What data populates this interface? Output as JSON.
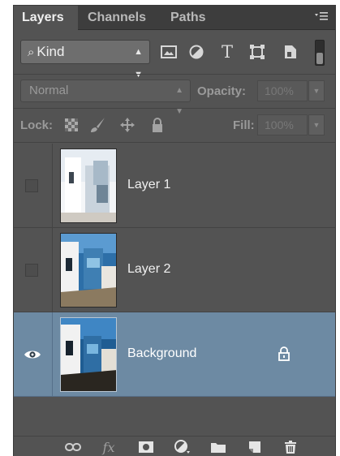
{
  "tabs": [
    {
      "label": "Layers",
      "active": true
    },
    {
      "label": "Channels",
      "active": false
    },
    {
      "label": "Paths",
      "active": false
    }
  ],
  "panel_menu_icon": "panel-menu-icon",
  "filter": {
    "kind_label": "Kind",
    "icons": [
      "pixel-filter-icon",
      "adjustment-filter-icon",
      "type-filter-icon",
      "shape-filter-icon",
      "smart-object-filter-icon"
    ],
    "type_glyph": "T",
    "toggle": "filter-toggle"
  },
  "blend": {
    "mode": "Normal",
    "opacity_label": "Opacity:",
    "opacity_value": "100%"
  },
  "lock": {
    "label": "Lock:",
    "icons": [
      "lock-transparent-icon",
      "lock-image-icon",
      "lock-position-icon",
      "lock-all-icon"
    ],
    "fill_label": "Fill:",
    "fill_value": "100%"
  },
  "layers": [
    {
      "name": "Layer 1",
      "visible": false,
      "locked": false,
      "selected": false
    },
    {
      "name": "Layer 2",
      "visible": false,
      "locked": false,
      "selected": false
    },
    {
      "name": "Background",
      "visible": true,
      "locked": true,
      "selected": true
    }
  ],
  "footer": {
    "icons": [
      "link-icon",
      "fx-icon",
      "mask-icon",
      "adjustment-icon",
      "folder-icon",
      "new-layer-icon",
      "trash-icon"
    ],
    "fx_label": "fx"
  },
  "colors": {
    "panel_bg": "#535353",
    "selected_row": "#6d8aa3",
    "tab_bar": "#3d3d3d"
  }
}
